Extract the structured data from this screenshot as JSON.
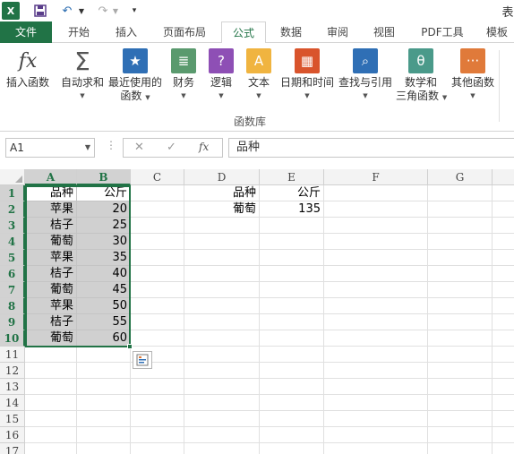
{
  "qat": {
    "logo": "X",
    "save_icon": "save-icon",
    "undo_icon": "undo-icon",
    "redo_icon": "redo-icon",
    "title_fragment": "表"
  },
  "tabs": [
    {
      "label": "文件"
    },
    {
      "label": "开始"
    },
    {
      "label": "插入"
    },
    {
      "label": "页面布局"
    },
    {
      "label": "公式"
    },
    {
      "label": "数据"
    },
    {
      "label": "审阅"
    },
    {
      "label": "视图"
    },
    {
      "label": "PDF工具"
    },
    {
      "label": "模板"
    }
  ],
  "active_tab": "公式",
  "ribbon": {
    "buttons": [
      {
        "label": "插入函数",
        "label2": "",
        "icon": "fx-icon"
      },
      {
        "label": "自动求和",
        "label2": "",
        "icon": "sigma-icon"
      },
      {
        "label": "最近使用的",
        "label2": "函数",
        "icon": "star-icon"
      },
      {
        "label": "财务",
        "label2": "",
        "icon": "finance-icon"
      },
      {
        "label": "逻辑",
        "label2": "",
        "icon": "logic-icon"
      },
      {
        "label": "文本",
        "label2": "",
        "icon": "text-icon"
      },
      {
        "label": "日期和时间",
        "label2": "",
        "icon": "calendar-icon"
      },
      {
        "label": "查找与引用",
        "label2": "",
        "icon": "lookup-icon"
      },
      {
        "label": "数学和",
        "label2": "三角函数",
        "icon": "theta-icon"
      },
      {
        "label": "其他函数",
        "label2": "",
        "icon": "more-functions-icon"
      }
    ],
    "group_label": "函数库"
  },
  "formula_bar": {
    "name_box": "A1",
    "cancel_icon": "cancel-icon",
    "enter_icon": "enter-icon",
    "fx_label": "fx",
    "content": "品种"
  },
  "grid": {
    "columns": [
      "A",
      "B",
      "C",
      "D",
      "E",
      "F",
      "G"
    ],
    "rows": [
      "1",
      "2",
      "3",
      "4",
      "5",
      "6",
      "7",
      "8",
      "9",
      "10",
      "11",
      "12",
      "13",
      "14",
      "15",
      "16",
      "17"
    ],
    "cells": {
      "A": [
        "品种",
        "苹果",
        "桔子",
        "葡萄",
        "苹果",
        "桔子",
        "葡萄",
        "苹果",
        "桔子",
        "葡萄"
      ],
      "B": [
        "公斤",
        "20",
        "25",
        "30",
        "35",
        "40",
        "45",
        "50",
        "55",
        "60"
      ],
      "D": [
        "品种",
        "葡萄"
      ],
      "E": [
        "公斤",
        "135"
      ]
    },
    "selection": "A1:B10"
  },
  "quick_analysis_icon": "quick-analysis-icon"
}
